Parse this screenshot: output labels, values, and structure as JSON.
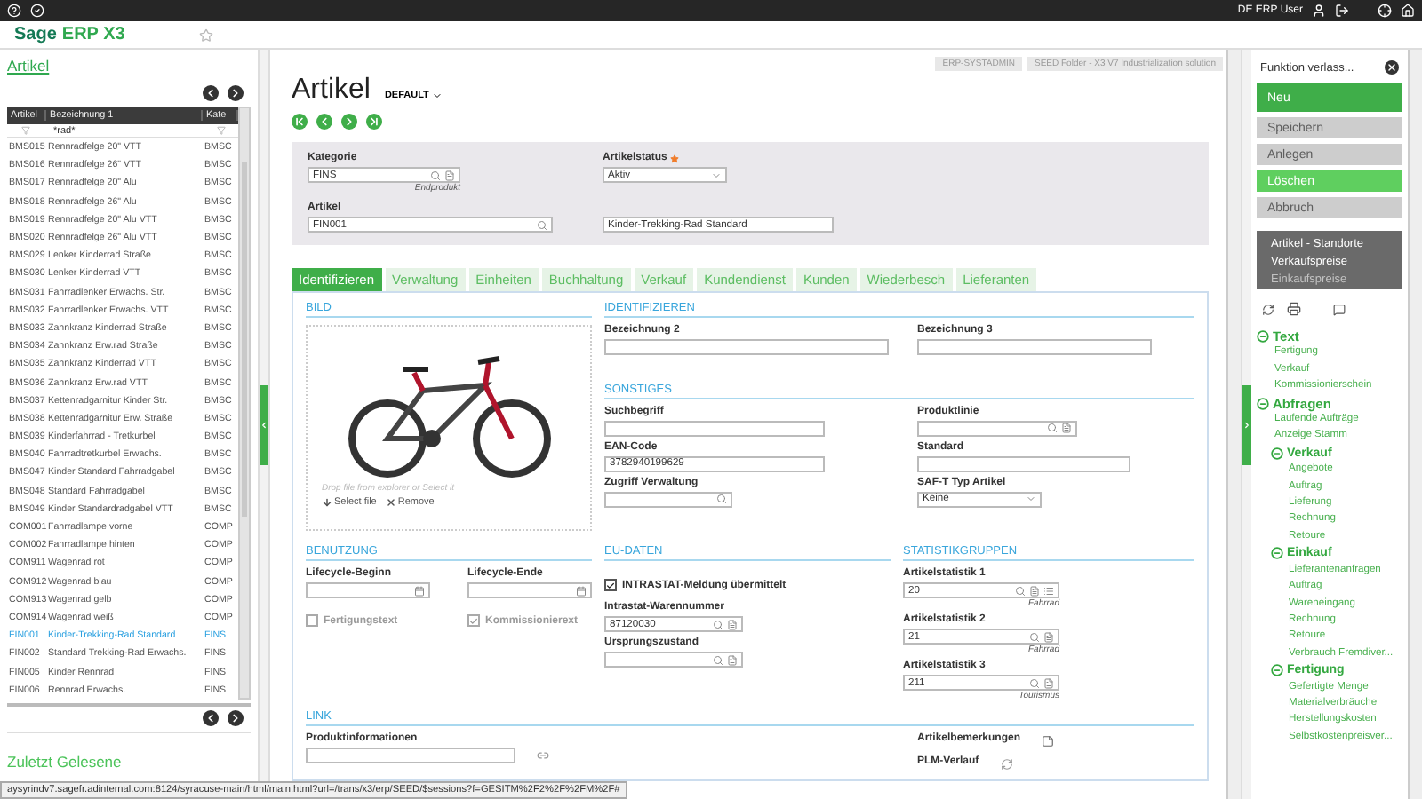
{
  "topbar": {
    "user": "DE ERP User"
  },
  "brand": {
    "name": "Sage",
    "product": "ERP X3"
  },
  "left_panel": {
    "title": "Artikel",
    "columns": [
      "Artikel",
      "Bezeichnung 1",
      "Kate"
    ],
    "filter": "*rad*",
    "rows": [
      {
        "code": "BMS015",
        "name": "Rennradfelge 20\" VTT",
        "category": "BMSC",
        "selected": false
      },
      {
        "code": "BMS016",
        "name": "Rennradfelge 26\" VTT",
        "category": "BMSC",
        "selected": false
      },
      {
        "code": "BMS017",
        "name": "Rennradfelge 20\" Alu",
        "category": "BMSC",
        "selected": false
      },
      {
        "code": "BMS018",
        "name": "Rennradfelge 26\" Alu",
        "category": "BMSC",
        "selected": false
      },
      {
        "code": "BMS019",
        "name": "Rennradfelge 20\" Alu VTT",
        "category": "BMSC",
        "selected": false
      },
      {
        "code": "BMS020",
        "name": "Rennradfelge 26\" Alu VTT",
        "category": "BMSC",
        "selected": false
      },
      {
        "code": "BMS029",
        "name": "Lenker Kinderrad Straße",
        "category": "BMSC",
        "selected": false
      },
      {
        "code": "BMS030",
        "name": "Lenker Kinderrad VTT",
        "category": "BMSC",
        "selected": false
      },
      {
        "code": "BMS031",
        "name": "Fahrradlenker Erwachs. Str.",
        "category": "BMSC",
        "selected": false
      },
      {
        "code": "BMS032",
        "name": "Fahrradlenker Erwachs. VTT",
        "category": "BMSC",
        "selected": false
      },
      {
        "code": "BMS033",
        "name": "Zahnkranz Kinderrad Straße",
        "category": "BMSC",
        "selected": false
      },
      {
        "code": "BMS034",
        "name": "Zahnkranz Erw.rad Straße",
        "category": "BMSC",
        "selected": false
      },
      {
        "code": "BMS035",
        "name": "Zahnkranz Kinderrad VTT",
        "category": "BMSC",
        "selected": false
      },
      {
        "code": "BMS036",
        "name": "Zahnkranz Erw.rad VTT",
        "category": "BMSC",
        "selected": false
      },
      {
        "code": "BMS037",
        "name": "Kettenradgarnitur Kinder Str.",
        "category": "BMSC",
        "selected": false
      },
      {
        "code": "BMS038",
        "name": "Kettenradgarnitur Erw. Straße",
        "category": "BMSC",
        "selected": false
      },
      {
        "code": "BMS039",
        "name": "Kinderfahrrad - Tretkurbel",
        "category": "BMSC",
        "selected": false
      },
      {
        "code": "BMS040",
        "name": "Fahrradtretkurbel Erwachs.",
        "category": "BMSC",
        "selected": false
      },
      {
        "code": "BMS047",
        "name": "Kinder Standard Fahrradgabel",
        "category": "BMSC",
        "selected": false
      },
      {
        "code": "BMS048",
        "name": "Standard Fahrradgabel",
        "category": "BMSC",
        "selected": false
      },
      {
        "code": "BMS049",
        "name": "Kinder Standardradgabel VTT",
        "category": "BMSC",
        "selected": false
      },
      {
        "code": "COM001",
        "name": "Fahrradlampe vorne",
        "category": "COMP",
        "selected": false
      },
      {
        "code": "COM002",
        "name": "Fahrradlampe hinten",
        "category": "COMP",
        "selected": false
      },
      {
        "code": "COM911",
        "name": "Wagenrad rot",
        "category": "COMP",
        "selected": false
      },
      {
        "code": "COM912",
        "name": "Wagenrad blau",
        "category": "COMP",
        "selected": false
      },
      {
        "code": "COM913",
        "name": "Wagenrad gelb",
        "category": "COMP",
        "selected": false
      },
      {
        "code": "COM914",
        "name": "Wagenrad weiß",
        "category": "COMP",
        "selected": false
      },
      {
        "code": "FIN001",
        "name": "Kinder-Trekking-Rad Standard",
        "category": "FINS",
        "selected": true
      },
      {
        "code": "FIN002",
        "name": "Standard Trekking-Rad Erwachs.",
        "category": "FINS",
        "selected": false
      },
      {
        "code": "FIN005",
        "name": "Kinder Rennrad",
        "category": "FINS",
        "selected": false
      },
      {
        "code": "FIN006",
        "name": "Rennrad Erwachs.",
        "category": "FINS",
        "selected": false
      }
    ],
    "footer": "Zuletzt Gelesene"
  },
  "page": {
    "title": "Artikel",
    "variant": "DEFAULT",
    "badges": [
      "ERP-SYSTADMIN",
      "SEED Folder - X3 V7 Industrialization solution"
    ],
    "header_fields": [
      {
        "label": "Kategorie",
        "kind": "lookup_doc",
        "value": "FINS",
        "note": "Endprodukt"
      },
      {
        "label": "Artikelstatus",
        "kind": "select",
        "value": "Aktiv",
        "required": true
      },
      {
        "label": "Artikel",
        "kind": "lookup",
        "value": "FIN001"
      },
      {
        "kind": "text",
        "value": "Kinder-Trekking-Rad Standard"
      }
    ],
    "tabs": [
      {
        "label": "Identifizieren",
        "selected": true
      },
      {
        "label": "Verwaltung",
        "selected": false
      },
      {
        "label": "Einheiten",
        "selected": false
      },
      {
        "label": "Buchhaltung",
        "selected": false
      },
      {
        "label": "Verkauf",
        "selected": false
      },
      {
        "label": "Kundendienst",
        "selected": false
      },
      {
        "label": "Kunden",
        "selected": false
      },
      {
        "label": "Wiederbesch",
        "selected": false
      },
      {
        "label": "Lieferanten",
        "selected": false
      }
    ],
    "image": {
      "title": "BILD",
      "hint": "Drop file from explorer or Select it",
      "actions": [
        "Select file",
        "Remove"
      ]
    },
    "sections": [
      {
        "title": "IDENTIFIZIEREN",
        "fields": [
          {
            "label": "Bezeichnung 2",
            "kind": "text"
          },
          {
            "label": "Bezeichnung 3",
            "kind": "text"
          }
        ]
      },
      {
        "title": "SONSTIGES",
        "fields": [
          {
            "label": "Suchbegriff",
            "kind": "text"
          },
          {
            "label": "Produktlinie",
            "kind": "lookup_doc"
          },
          {
            "label": "EAN-Code",
            "kind": "text",
            "value": "3782940199629"
          },
          {
            "label": "Standard",
            "kind": "text"
          },
          {
            "label": "Zugriff Verwaltung",
            "kind": "lookup"
          },
          {
            "label": "SAF-T Typ Artikel",
            "kind": "select",
            "value": "Keine"
          }
        ]
      },
      {
        "title": "BENUTZUNG",
        "fields": [
          {
            "label": "Lifecycle-Beginn",
            "kind": "date"
          },
          {
            "label": "Lifecycle-Ende",
            "kind": "date"
          },
          {
            "label": "Fertigungstext",
            "kind": "checkbox",
            "checked": false,
            "disabled": true
          },
          {
            "label": "Kommissionierext",
            "kind": "checkbox",
            "checked": true,
            "disabled": true
          }
        ]
      },
      {
        "title": "EU-DATEN",
        "fields": [
          {
            "label": "INTRASTAT-Meldung übermittelt",
            "kind": "checkbox",
            "checked": true,
            "disabled": false
          },
          {
            "label": "Intrastat-Warennummer",
            "kind": "lookup_doc",
            "value": "87120030"
          },
          {
            "label": "Ursprungszustand",
            "kind": "lookup_doc"
          }
        ]
      },
      {
        "title": "STATISTIKGRUPPEN",
        "fields": [
          {
            "label": "Artikelstatistik 1",
            "kind": "lookup_doc_more",
            "value": "20",
            "note": "Fahrrad"
          },
          {
            "label": "Artikelstatistik 2",
            "kind": "lookup_doc",
            "value": "21",
            "note": "Fahrrad"
          },
          {
            "label": "Artikelstatistik 3",
            "kind": "lookup_doc",
            "value": "211",
            "note": "Tourismus"
          }
        ]
      },
      {
        "title": "LINK",
        "fields": [
          {
            "label": "Produktinformationen",
            "kind": "link"
          },
          {
            "label": "Artikelbemerkungen",
            "kind": "note_icon"
          },
          {
            "label": "PLM-Verlauf",
            "kind": "history_icon"
          }
        ]
      }
    ]
  },
  "right_panel": {
    "close_label": "Funktion verlass...",
    "buttons": [
      {
        "label": "Neu",
        "kind": "primary",
        "disabled": false
      },
      {
        "label": "Speichern",
        "kind": "primary",
        "disabled": true
      },
      {
        "label": "Anlegen",
        "kind": "primary",
        "disabled": true
      },
      {
        "label": "Löschen",
        "kind": "secondary",
        "disabled": false
      },
      {
        "label": "Abbruch",
        "kind": "primary",
        "disabled": true
      }
    ],
    "links": [
      {
        "label": "Artikel - Standorte",
        "disabled": false
      },
      {
        "label": "Verkaufspreise",
        "disabled": false
      },
      {
        "label": "Einkaufspreise",
        "disabled": true
      }
    ],
    "tree": [
      {
        "label": "Text",
        "expanded": true,
        "children": [
          {
            "label": "Fertigung"
          },
          {
            "label": "Verkauf"
          },
          {
            "label": "Kommissionierschein"
          }
        ]
      },
      {
        "label": "Abfragen",
        "expanded": true,
        "children": [
          {
            "label": "Laufende Aufträge"
          },
          {
            "label": "Anzeige Stamm"
          },
          {
            "label": "Verkauf",
            "expanded": true,
            "children": [
              {
                "label": "Angebote"
              },
              {
                "label": "Auftrag"
              },
              {
                "label": "Lieferung"
              },
              {
                "label": "Rechnung"
              },
              {
                "label": "Retoure"
              }
            ]
          },
          {
            "label": "Einkauf",
            "expanded": true,
            "children": [
              {
                "label": "Lieferantenanfragen"
              },
              {
                "label": "Auftrag"
              },
              {
                "label": "Wareneingang"
              },
              {
                "label": "Rechnung"
              },
              {
                "label": "Retoure"
              },
              {
                "label": "Verbrauch Fremdiver..."
              }
            ]
          },
          {
            "label": "Fertigung",
            "expanded": true,
            "children": [
              {
                "label": "Gefertigte Menge"
              },
              {
                "label": "Materialverbräuche"
              },
              {
                "label": "Herstellungskosten"
              },
              {
                "label": "Selbstkostenpreisver..."
              }
            ]
          }
        ]
      }
    ]
  },
  "status_bar": "aysyrindv7.sagefr.adinternal.com:8124/syracuse-main/html/main.html?url=/trans/x3/erp/SEED/$sessions?f=GESITM%2F2%2F%2FM%2F#"
}
